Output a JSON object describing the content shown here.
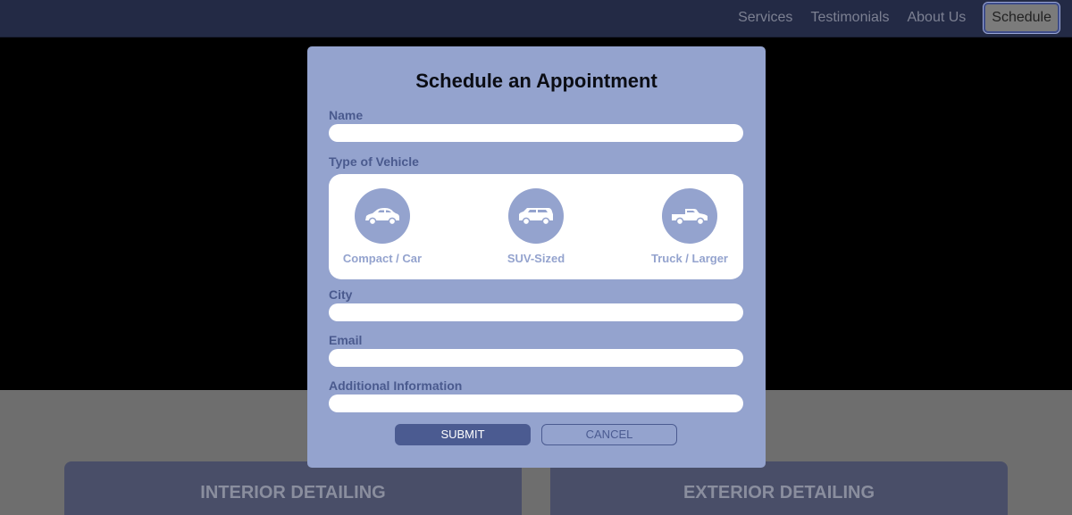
{
  "nav": {
    "links": [
      "Services",
      "Testimonials",
      "About Us"
    ],
    "schedule_label": "Schedule"
  },
  "services": {
    "interior_title": "INTERIOR DETAILING",
    "exterior_title": "EXTERIOR DETAILING"
  },
  "modal": {
    "title": "Schedule an Appointment",
    "name_label": "Name",
    "name_value": "",
    "vehicle_label": "Type of Vehicle",
    "vehicles": [
      {
        "label": "Compact / Car",
        "icon": "car-icon"
      },
      {
        "label": "SUV-Sized",
        "icon": "suv-icon"
      },
      {
        "label": "Truck / Larger",
        "icon": "truck-icon"
      }
    ],
    "city_label": "City",
    "city_value": "",
    "email_label": "Email",
    "email_value": "",
    "info_label": "Additional Information",
    "info_value": "",
    "submit_label": "SUBMIT",
    "cancel_label": "CANCEL"
  },
  "colors": {
    "navbar": "#232a45",
    "modal_bg": "#94a3ce",
    "accent": "#4b5b91"
  }
}
